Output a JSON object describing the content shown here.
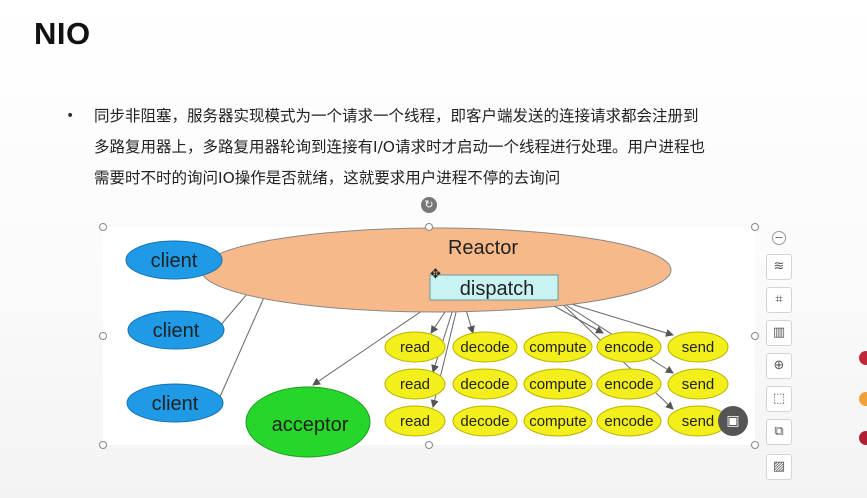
{
  "slide": {
    "title": "NIO",
    "bullet": "•",
    "text_lines": [
      "同步非阻塞，服务器实现模式为一个请求一个线程，即客户端发送的连接请求都会注册到",
      "多路复用器上，多路复用器轮询到连接有I/O请求时才启动一个线程进行处理。用户进程也",
      "需要时不时的询问IO操作是否就绪，这就要求用户进程不停的去询问"
    ]
  },
  "diagram": {
    "reactor_label": "Reactor",
    "dispatch_label": "dispatch",
    "acceptor_label": "acceptor",
    "clients": [
      "client",
      "client",
      "client"
    ],
    "rows": [
      [
        "read",
        "decode",
        "compute",
        "encode",
        "send"
      ],
      [
        "read",
        "decode",
        "compute",
        "encode",
        "send"
      ],
      [
        "read",
        "decode",
        "compute",
        "encode",
        "send"
      ]
    ],
    "colors": {
      "reactor": "#f7b98a",
      "client": "#1e9ae6",
      "acceptor": "#27d62a",
      "task": "#f3ef1a",
      "dispatch_box": "#c9f3f3"
    }
  },
  "toolbar": {
    "icons": [
      "minus-icon",
      "layers-icon",
      "crop-icon",
      "layout-icon",
      "zoom-in-icon",
      "image-select-icon",
      "replace-image-icon",
      "pattern-icon"
    ]
  }
}
